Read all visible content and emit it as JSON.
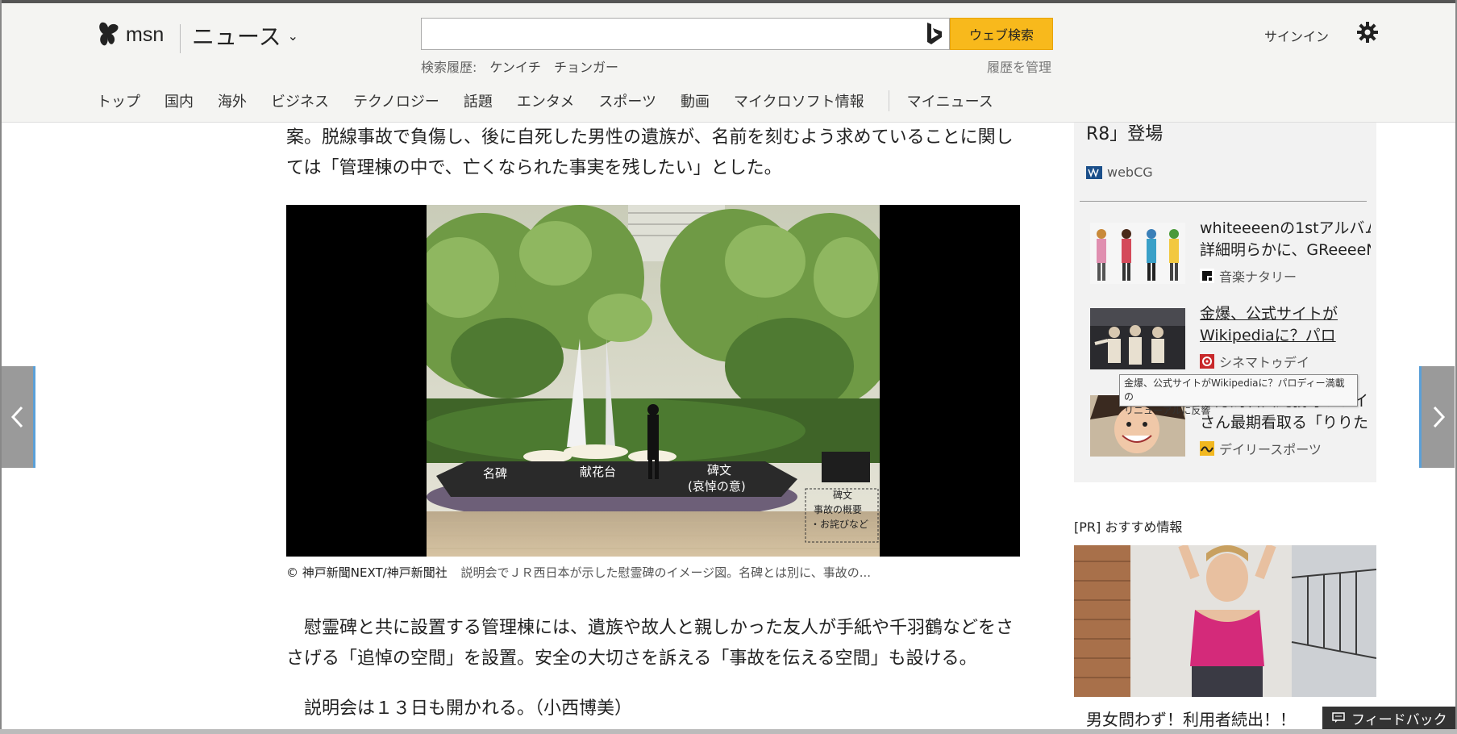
{
  "header": {
    "logo_text": "msn",
    "section_title": "ニュース",
    "search": {
      "placeholder": "",
      "button_label": "ウェブ検索"
    },
    "history": {
      "label": "検索履歴:",
      "items": [
        "ケンイチ",
        "チョンガー"
      ],
      "manage_label": "履歴を管理"
    },
    "signin_label": "サインイン",
    "nav": [
      "トップ",
      "国内",
      "海外",
      "ビジネス",
      "テクノロジー",
      "話題",
      "エンタメ",
      "スポーツ",
      "動画",
      "マイクロソフト情報"
    ],
    "my_news": "マイニュース"
  },
  "article": {
    "para1": "案。脱線事故で負傷し、後に自死した男性の遺族が、名前を刻むよう求めていることに関しては「管理棟の中で、亡くなられた事実を残したい」とした。",
    "photo_labels": {
      "memorial": "名碑",
      "flower": "献花台",
      "inscription_line1": "碑文",
      "inscription_line2": "(哀悼の意)",
      "note_line1": "碑文",
      "note_line2": "事故の概要",
      "note_line3": "・お詫びなど"
    },
    "caption_credit": "© 神戸新聞NEXT/神戸新聞社",
    "caption_text": "説明会でＪＲ西日本が示した慰霊碑のイメージ図。名碑とは別に、事故の...",
    "para2": "　慰霊碑と共に設置する管理棟には、遺族や故人と親しかった友人が手紙や千羽鶴などをささげる「追悼の空間」を設置。安全の大切さを訴える「事故を伝える空間」も設ける。",
    "para3": "　説明会は１３日も開かれる。（小西博美）"
  },
  "sidebar": {
    "top_title": "R8」登場",
    "top_source": "webCG",
    "stories": [
      {
        "title_line1": "whiteeeenの1stアルバム",
        "title_line2": "詳細明らかに、GReeeeN",
        "source": "音楽ナタリー"
      },
      {
        "title_line1": "金爆、公式サイトが",
        "title_line2": "Wikipediaに？パロ",
        "source": "シネマトゥデイ"
      },
      {
        "title_line1": "十万馬石田純義母ウライ",
        "title_line2": "さん最期看取る「りりた",
        "source": "デイリースポーツ"
      }
    ],
    "tooltip_line1": "金爆、公式サイトがWikipediaに？パロディー満載の",
    "tooltip_line2": "リニューアルに反響",
    "pr_label": "[PR] おすすめ情報",
    "pr_title": "男女問わず！利用者続出！！"
  },
  "feedback_label": "フィードバック",
  "colors": {
    "search_button": "#f8b91c",
    "arrow_accent": "#5aa0d8"
  }
}
